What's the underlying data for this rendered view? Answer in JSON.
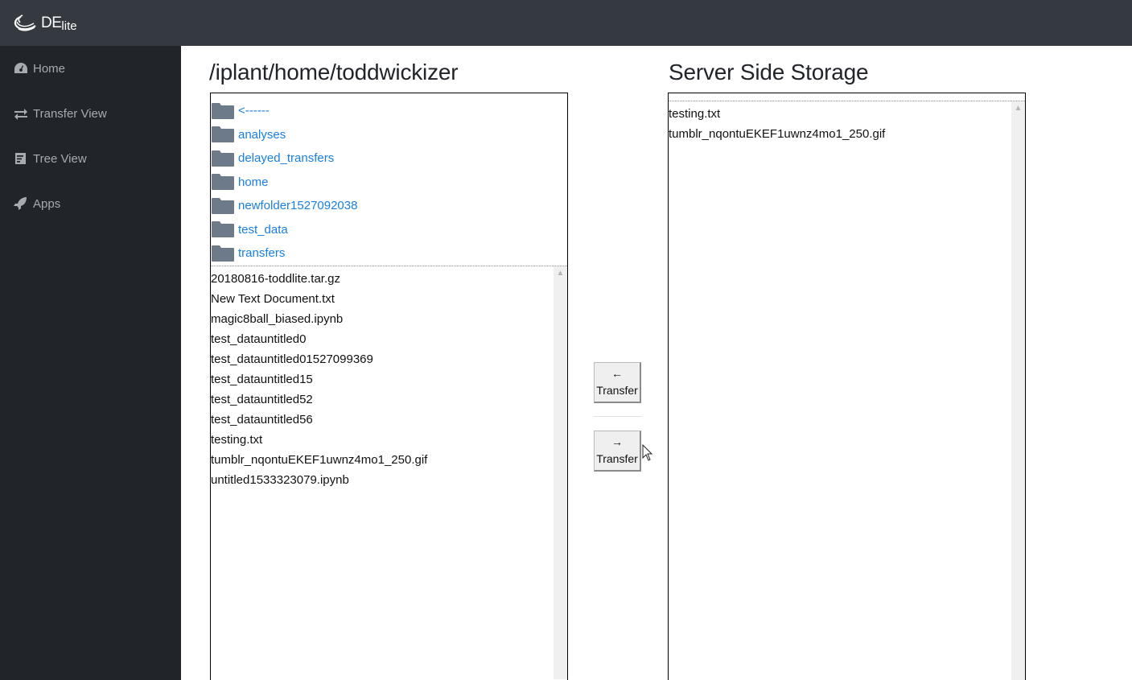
{
  "brand": {
    "name": "DE",
    "suffix": "lite",
    "logo_icon": "swirl-logo-icon"
  },
  "sidebar": {
    "items": [
      {
        "label": "Home",
        "icon": "dashboard-gauge-icon"
      },
      {
        "label": "Transfer View",
        "icon": "exchange-arrows-icon"
      },
      {
        "label": "Tree View",
        "icon": "list-alt-icon"
      },
      {
        "label": "Apps",
        "icon": "rocket-icon"
      }
    ]
  },
  "left_panel": {
    "title": "/iplant/home/toddwickizer",
    "folders": [
      {
        "label": "<------"
      },
      {
        "label": "analyses"
      },
      {
        "label": "delayed_transfers"
      },
      {
        "label": "home"
      },
      {
        "label": "newfolder1527092038"
      },
      {
        "label": "test_data"
      },
      {
        "label": "transfers"
      }
    ],
    "files": [
      "20180816-toddlite.tar.gz",
      "New Text Document.txt",
      "magic8ball_biased.ipynb",
      "test_datauntitled0",
      "test_datauntitled01527099369",
      "test_datauntitled15",
      "test_datauntitled52",
      "test_datauntitled56",
      "testing.txt",
      "tumblr_nqontuEKEF1uwnz4mo1_250.gif",
      "untitled1533323079.ipynb"
    ]
  },
  "right_panel": {
    "title": "Server Side Storage",
    "files": [
      "testing.txt",
      "tumblr_nqontuEKEF1uwnz4mo1_250.gif"
    ]
  },
  "transfer_buttons": {
    "left": {
      "arrow": "←",
      "label": "Transfer"
    },
    "right": {
      "arrow": "→",
      "label": "Transfer"
    }
  },
  "colors": {
    "topbar": "#343a40",
    "sidebar": "#212529",
    "link": "#1a7fe0",
    "folder_icon": "#6c7a89"
  }
}
